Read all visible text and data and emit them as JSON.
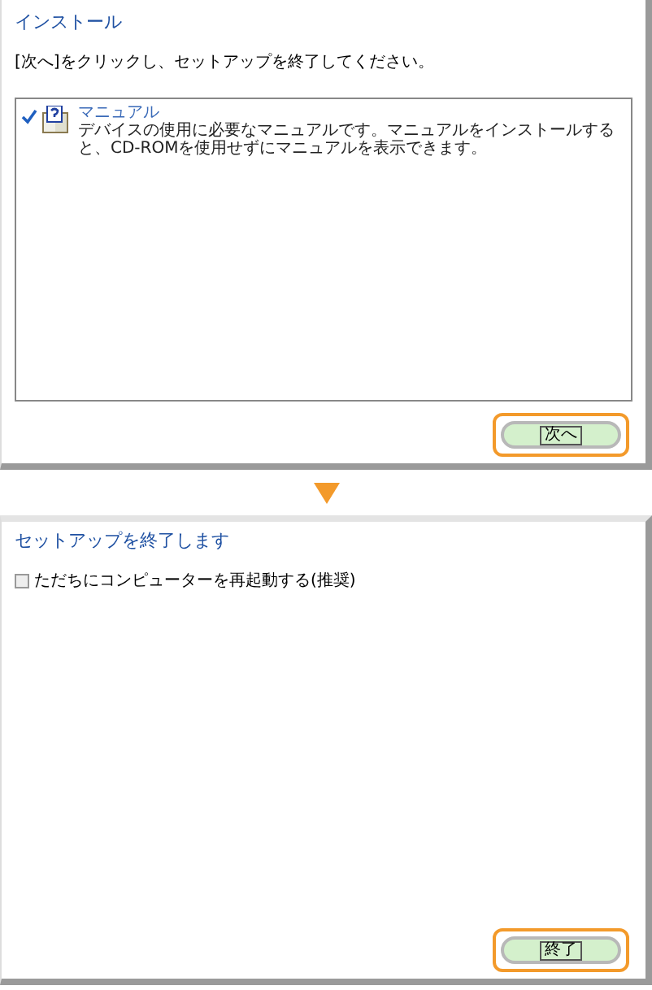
{
  "install_screen": {
    "title": "インストール",
    "instruction": "[次へ]をクリックし、セットアップを終了してください。",
    "items": [
      {
        "name": "マニュアル",
        "description": "デバイスの使用に必要なマニュアルです。マニュアルをインストールすると、CD-ROMを使用せずにマニュアルを表示できます。",
        "checked": true
      }
    ],
    "button": {
      "label": "次へ",
      "highlighted": true
    }
  },
  "finish_screen": {
    "title": "セットアップを終了します",
    "checkbox": {
      "label": "ただちにコンピューターを再起動する(推奨)",
      "checked": false
    },
    "button": {
      "label": "終了",
      "highlighted": true
    }
  }
}
